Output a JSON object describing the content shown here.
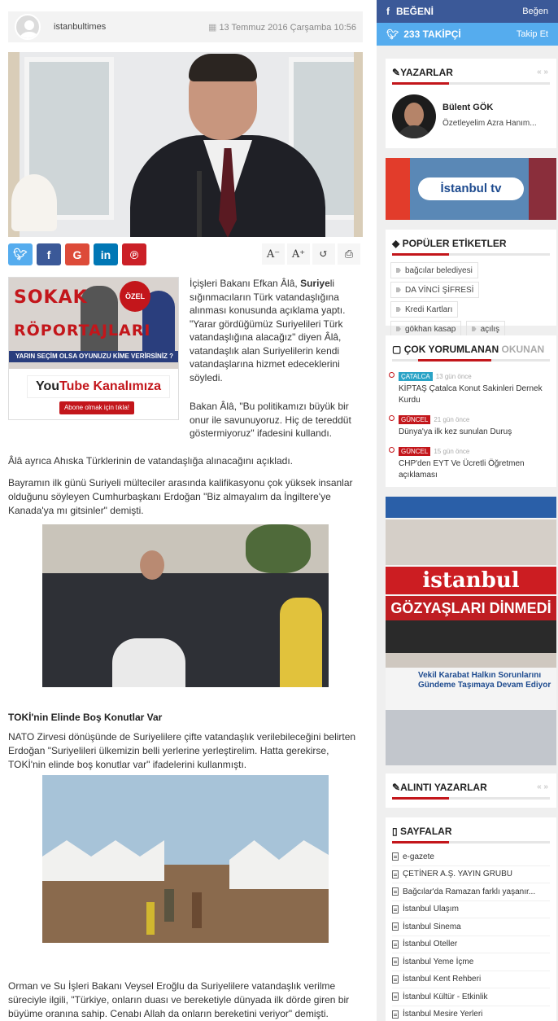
{
  "article": {
    "author": "istanbultimes",
    "date": "13 Temmuz 2016 Çarşamba 10:56",
    "p1_pre": "İçişleri Bakanı Efkan Âlâ,",
    "p1_bold": "Suriye",
    "p1_post": "li sığınmacıların Türk vatandaşlığına alınması konusunda açıklama yaptı. \"Yarar gördüğümüz Suriyelileri Türk vatandaşlığına alacağız\" diyen Âlâ, vatandaşlık alan Suriyelilerin kendi vatandaşlarına hizmet edeceklerini söyledi.",
    "p2": "Bakan Âlâ, \"Bu politikamızı büyük bir onur ile savunuyoruz. Hiç de tereddüt göstermiyoruz\" ifadesini kullandı.",
    "p3": "Âlâ ayrıca Ahıska Türklerinin de vatandaşlığa alınacağını açıkladı.",
    "p4": "Bayramın ilk günü Suriyeli mülteciler arasında kalifikasyonu çok yüksek insanlar olduğunu söyleyen Cumhurbaşkanı Erdoğan \"Biz almayalım da İngiltere'ye Kanada'ya mı gitsinler\" demişti.",
    "subheading": "TOKİ'nin Elinde Boş Konutlar Var",
    "p5": "NATO Zirvesi dönüşünde de Suriyelilere çifte vatandaşlık verilebileceğini belirten Erdoğan \"Suriyelileri ülkemizin belli yerlerine yerleştirelim. Hatta gerekirse, TOKİ'nin elinde boş konutlar var\" ifadelerini kullanmıştı.",
    "p6": "Orman ve Su İşleri Bakanı Veysel Eroğlu da Suriyelilere vatandaşlık verilme süreciyle ilgili, \"Türkiye, onların duası ve bereketiyle dünyada ilk dörde giren bir büyüme oranına sahip. Cenabı Allah da onların bereketini veriyor\" demişti."
  },
  "share": [
    "twitter-icon",
    "facebook-icon",
    "google-icon",
    "linkedin-icon",
    "pinterest-icon"
  ],
  "tools": {
    "font_down": "A⁻",
    "font_up": "A⁺",
    "reset": "↺",
    "print": "⎙"
  },
  "ad": {
    "line1": "SOKAK",
    "line2": "RÖPORTAJLARI",
    "band": "YARIN SEÇİM OLSA OYUNUZU KİME VERİRSİNİZ ?",
    "badge": "ÖZEL",
    "yt_you": "You",
    "yt_rest": "Tube Kanalımıza",
    "subscribe": "Abone olmak için tıkla!"
  },
  "sidebar": {
    "facebook": {
      "label": "BEĞENİ",
      "action": "Beğen"
    },
    "twitter": {
      "label": "233 TAKİPÇİ",
      "action": "Takip Et"
    },
    "writers": {
      "title": "YAZARLAR",
      "name": "Bülent GÖK",
      "headline": "Özetleyelim Azra Hanım..."
    },
    "banner": {
      "brand": "İstanbul tv"
    },
    "tags": {
      "title": "POPÜLER ETİKETLER",
      "items": [
        "bağcılar belediyesi",
        "DA VİNCİ ŞİFRESİ",
        "Kredi Kartları",
        "gökhan kasap",
        "açılış"
      ]
    },
    "tabs": {
      "t1": "ÇOK",
      "t2": "YORUMLANAN",
      "t3": "OKUNAN"
    },
    "comments": [
      {
        "cat": "ÇATALCA",
        "ago": "13 gün önce",
        "title": "KİPTAŞ Çatalca Konut Sakinleri Dernek Kurdu"
      },
      {
        "cat": "GÜNCEL",
        "ago": "21 gün önce",
        "title": "Dünya'ya ilk kez sunulan Duruş"
      },
      {
        "cat": "GÜNCEL",
        "ago": "15 gün önce",
        "title": "CHP'den EYT Ve Ücretli Öğretmen açıklaması"
      }
    ],
    "newspaper": {
      "brand": "istanbul",
      "headline": "GÖZYAŞLARI DİNMEDİ",
      "sub": "Vekil Karabat Halkın Sorunlarını Gündeme Taşımaya Devam Ediyor"
    },
    "quotes_title": "ALINTI YAZARLAR",
    "pages": {
      "title": "SAYFALAR",
      "items": [
        "e-gazete",
        "ÇETİNER A.Ş. YAYIN GRUBU",
        "Bağcılar'da Ramazan farklı yaşanır...",
        "İstanbul Ulaşım",
        "İstanbul Sinema",
        "İstanbul Oteller",
        "İstanbul Yeme İçme",
        "İstanbul Kent Rehberi",
        "İstanbul Kültür - Etkinlik",
        "İstanbul Mesire Yerleri"
      ]
    }
  },
  "colors": {
    "accent": "#c3161b",
    "facebook": "#3b5998",
    "twitter": "#55acee"
  }
}
